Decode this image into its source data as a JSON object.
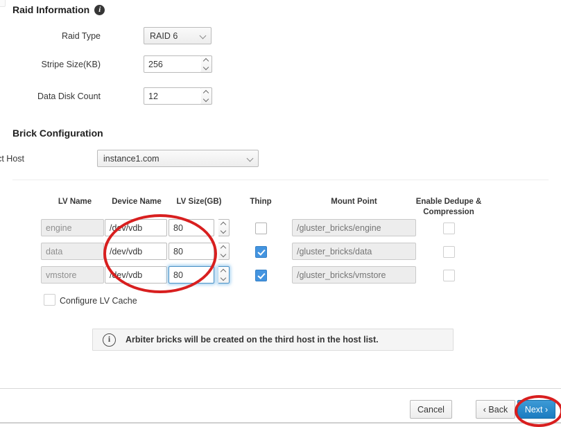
{
  "raid_section": {
    "title": "Raid Information",
    "info_icon": "info-circle-filled-icon",
    "fields": [
      {
        "label": "Raid Type",
        "value": "RAID 6",
        "control": "select"
      },
      {
        "label": "Stripe Size(KB)",
        "value": "256",
        "control": "spinner"
      },
      {
        "label": "Data Disk Count",
        "value": "12",
        "control": "spinner"
      }
    ]
  },
  "brick_section": {
    "title": "Brick Configuration",
    "host_label": "Select Host",
    "host_value": "instance1.com",
    "columns": [
      "LV Name",
      "Device Name",
      "LV Size(GB)",
      "Thinp",
      "Mount Point",
      "Enable Dedupe &",
      "Compression"
    ],
    "rows": [
      {
        "lv_name": "engine",
        "device_name": "/dev/vdb",
        "lv_size": "80",
        "thinp_checked": false,
        "mount_point": "/gluster_bricks/engine",
        "dedupe_checked": false,
        "focused": false
      },
      {
        "lv_name": "data",
        "device_name": "/dev/vdb",
        "lv_size": "80",
        "thinp_checked": true,
        "mount_point": "/gluster_bricks/data",
        "dedupe_checked": false,
        "focused": false
      },
      {
        "lv_name": "vmstore",
        "device_name": "/dev/vdb",
        "lv_size": "80",
        "thinp_checked": true,
        "mount_point": "/gluster_bricks/vmstore",
        "dedupe_checked": false,
        "focused": true
      }
    ],
    "lv_cache_label": "Configure LV Cache",
    "lv_cache_checked": false
  },
  "alert": {
    "icon": "info-circle-outline-icon",
    "text": "Arbiter bricks will be created on the third host in the host list."
  },
  "footer": {
    "cancel_label": "Cancel",
    "back_label": "‹ Back",
    "next_label": "Next ›"
  },
  "colors": {
    "primary_button": "#1b7cc0",
    "checkbox_checked": "#4394e0",
    "annotation": "#d81f1f",
    "focus_ring": "#4a90c4"
  }
}
